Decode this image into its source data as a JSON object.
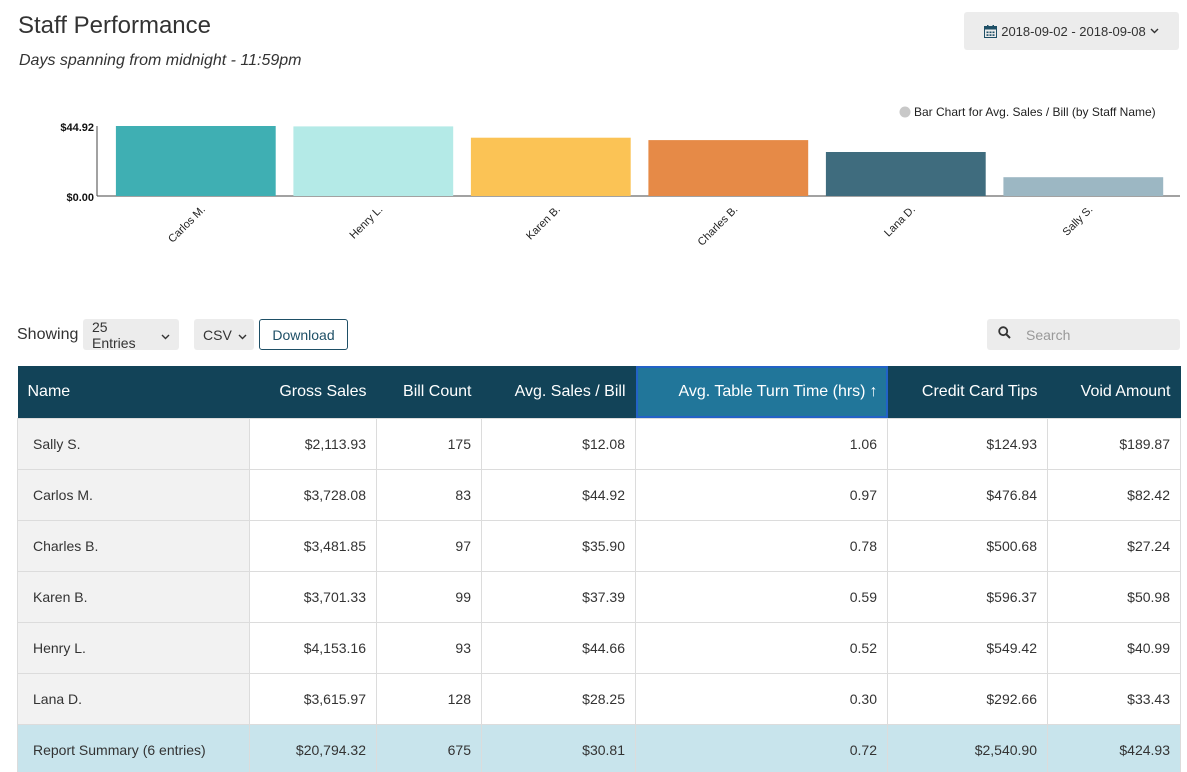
{
  "header": {
    "title": "Staff Performance",
    "subtitle": "Days spanning from midnight - 11:59pm",
    "date_range": "2018-09-02 - 2018-09-08"
  },
  "chart_data": {
    "type": "bar",
    "legend": "Bar Chart for Avg. Sales / Bill (by Staff Name)",
    "legend_position": "top-right",
    "categories": [
      "Carlos M.",
      "Henry L.",
      "Karen B.",
      "Charles B.",
      "Lana D.",
      "Sally S."
    ],
    "values": [
      44.92,
      44.66,
      37.39,
      35.9,
      28.25,
      12.08
    ],
    "colors": [
      "#3fafb3",
      "#b4eae7",
      "#fbc355",
      "#e68a47",
      "#3f6c7e",
      "#9cb7c3"
    ],
    "ylim": [
      0,
      44.92
    ],
    "y_ticks": [
      "$44.92",
      "$0.00"
    ],
    "grid": false
  },
  "toolbar": {
    "showing_label": "Showing",
    "entries_value": "25 Entries",
    "format_value": "CSV",
    "download_label": "Download",
    "search_placeholder": "Search"
  },
  "table": {
    "columns": [
      "Name",
      "Gross Sales",
      "Bill Count",
      "Avg. Sales / Bill",
      "Avg. Table Turn Time (hrs)",
      "Credit Card Tips",
      "Void Amount"
    ],
    "sort_indicator": "↑",
    "rows": [
      [
        "Sally S.",
        "$2,113.93",
        "175",
        "$12.08",
        "1.06",
        "$124.93",
        "$189.87"
      ],
      [
        "Carlos M.",
        "$3,728.08",
        "83",
        "$44.92",
        "0.97",
        "$476.84",
        "$82.42"
      ],
      [
        "Charles B.",
        "$3,481.85",
        "97",
        "$35.90",
        "0.78",
        "$500.68",
        "$27.24"
      ],
      [
        "Karen B.",
        "$3,701.33",
        "99",
        "$37.39",
        "0.59",
        "$596.37",
        "$50.98"
      ],
      [
        "Henry L.",
        "$4,153.16",
        "93",
        "$44.66",
        "0.52",
        "$549.42",
        "$40.99"
      ],
      [
        "Lana D.",
        "$3,615.97",
        "128",
        "$28.25",
        "0.30",
        "$292.66",
        "$33.43"
      ]
    ],
    "summary": [
      "Report Summary (6 entries)",
      "$20,794.32",
      "675",
      "$30.81",
      "0.72",
      "$2,540.90",
      "$424.93"
    ]
  }
}
